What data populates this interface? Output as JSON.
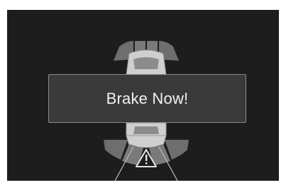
{
  "alert": {
    "message": "Brake Now!"
  },
  "icons": {
    "car": "car-top-view-icon",
    "warning": "warning-triangle-icon"
  },
  "colors": {
    "background": "#1d1d1d",
    "sensor_zone": "#6e6e6e",
    "alert_box": "#3a3a3a",
    "alert_border": "#8a8a8a",
    "text": "#f2f2f2"
  }
}
